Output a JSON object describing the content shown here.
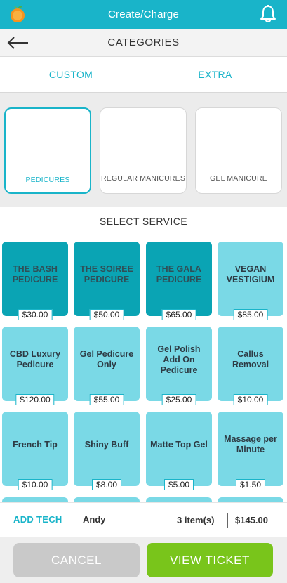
{
  "header": {
    "title": "Create/Charge"
  },
  "nav": {
    "title": "CATEGORIES"
  },
  "tabs": [
    {
      "label": "CUSTOM"
    },
    {
      "label": "EXTRA"
    }
  ],
  "categories": [
    {
      "label": "PEDICURES",
      "selected": true
    },
    {
      "label": "REGULAR MANICURES",
      "selected": false
    },
    {
      "label": "GEL MANICURE",
      "selected": false
    }
  ],
  "section_title": "SELECT SERVICE",
  "services": [
    {
      "name": "THE BASH PEDICURE",
      "price": "$30.00",
      "style": "dark"
    },
    {
      "name": "THE SOIREE PEDICURE",
      "price": "$50.00",
      "style": "dark"
    },
    {
      "name": "THE GALA PEDICURE",
      "price": "$65.00",
      "style": "dark"
    },
    {
      "name": "VEGAN VESTIGIUM",
      "price": "$85.00",
      "style": "light"
    },
    {
      "name": "CBD Luxury Pedicure",
      "price": "$120.00",
      "style": "light"
    },
    {
      "name": "Gel Pedicure Only",
      "price": "$55.00",
      "style": "light"
    },
    {
      "name": "Gel Polish Add On Pedicure",
      "price": "$25.00",
      "style": "light"
    },
    {
      "name": "Callus Removal",
      "price": "$10.00",
      "style": "light"
    },
    {
      "name": "French Tip",
      "price": "$10.00",
      "style": "light"
    },
    {
      "name": "Shiny Buff",
      "price": "$8.00",
      "style": "light"
    },
    {
      "name": "Matte Top Gel",
      "price": "$5.00",
      "style": "light"
    },
    {
      "name": "Massage per Minute",
      "price": "$1.50",
      "style": "light"
    },
    {
      "name": "",
      "price": "",
      "style": "light"
    },
    {
      "name": "",
      "price": "",
      "style": "light"
    },
    {
      "name": "",
      "price": "",
      "style": "light"
    },
    {
      "name": "",
      "price": "",
      "style": "light"
    }
  ],
  "summary": {
    "add_tech": "ADD TECH",
    "tech_name": "Andy",
    "items": "3 item(s)",
    "total": "$145.00"
  },
  "footer": {
    "cancel": "CANCEL",
    "view_ticket": "VIEW TICKET"
  },
  "colors": {
    "accent": "#19b4c9",
    "service_dark": "#0aa4b4",
    "service_light": "#7ad9e6",
    "view_button": "#79c51b",
    "cancel_button": "#c9c9c9"
  }
}
